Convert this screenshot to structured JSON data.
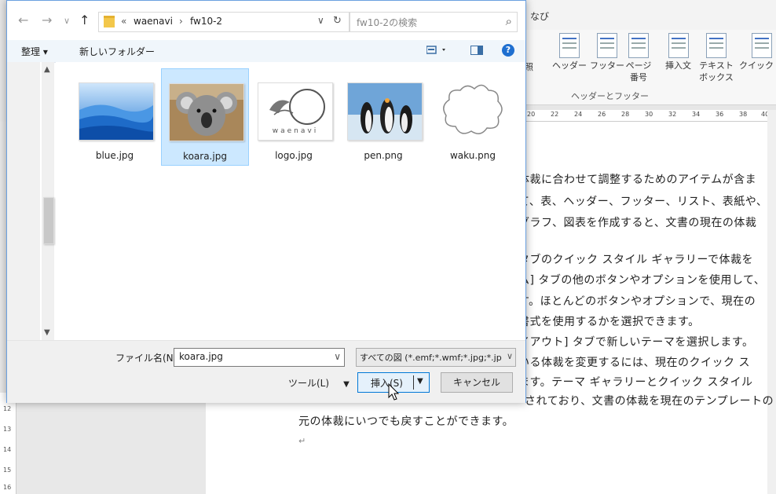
{
  "word": {
    "ribbon_title": "なび",
    "ribbon_buttons": [
      {
        "label": "参照"
      },
      {
        "label": "ヘッダー"
      },
      {
        "label": "フッター"
      },
      {
        "label": "ページ\n番号"
      },
      {
        "label": "挿入文"
      },
      {
        "label": "テキスト\nボックス"
      },
      {
        "label": "クイック パ"
      }
    ],
    "group_label": "ヘッダーとフッター",
    "ruler_numbers": [
      "20",
      "22",
      "24",
      "26",
      "28",
      "30",
      "32",
      "34",
      "36",
      "38",
      "40"
    ],
    "vruler_numbers": [
      "12",
      "13",
      "14",
      "15",
      "16"
    ],
    "doc_lines_right": [
      "体裁に合わせて調整するためのアイテムが含ま",
      "て、表、ヘッダー、フッター、リスト、表紙や、",
      "グラフ、図表を作成すると、文書の現在の体裁",
      "タブのクイック スタイル ギャラリーで体裁を",
      "ム] タブの他のボタンやオプションを使用して、",
      "す。ほとんどのボタンやオプションで、現在の",
      "書式を使用するかを選択できます。",
      "イアウト] タブで新しいテーマを選択します。",
      "いる体裁を変更するには、現在のクイック ス",
      "ます。テーマ ギャラリーとクイック スタイル",
      "されており、文書の体裁を現在のテンプレートの"
    ],
    "doc_lines_full": [
      "元の体裁にいつでも戻すことができます。"
    ],
    "paragraph_mark": "↵"
  },
  "dialog": {
    "nav": {
      "back": "←",
      "forward": "→",
      "recent": "∨",
      "up": "↑",
      "breadcrumb_prefix": "«",
      "crumbs": [
        "waenavi",
        "fw10-2"
      ],
      "crumb_sep": "›",
      "search_placeholder": "fw10-2の検索"
    },
    "commands": {
      "organize": "整理 ▾",
      "new_folder": "新しいフォルダー",
      "help": "?"
    },
    "files": [
      {
        "name": "blue.jpg",
        "selected": false
      },
      {
        "name": "koara.jpg",
        "selected": true
      },
      {
        "name": "logo.jpg",
        "selected": false
      },
      {
        "name": "pen.png",
        "selected": false
      },
      {
        "name": "waku.png",
        "selected": false
      }
    ],
    "logo_text": "waenavi",
    "filename_label": "ファイル名(N):",
    "filename_value": "koara.jpg",
    "filter_value": "すべての図 (*.emf;*.wmf;*.jpg;*.jp",
    "tools_label": "ツール(L)",
    "insert_label": "挿入(S)",
    "cancel_label": "キャンセル"
  },
  "colors": {
    "accent": "#0078d7",
    "selection": "#cce8ff",
    "help": "#1e6fd0"
  }
}
